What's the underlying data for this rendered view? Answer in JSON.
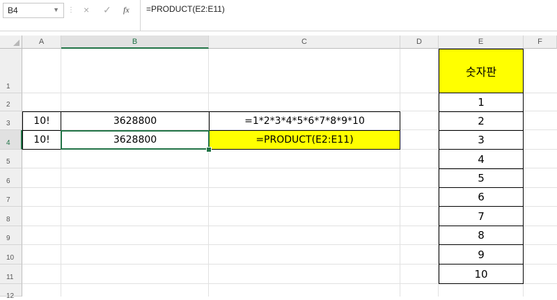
{
  "formula_bar": {
    "name_box": "B4",
    "cancel_icon": "×",
    "enter_icon": "✓",
    "fx_label": "fx",
    "formula": "=PRODUCT(E2:E11)"
  },
  "columns": [
    "A",
    "B",
    "C",
    "D",
    "E",
    "F"
  ],
  "rows": [
    "1",
    "2",
    "3",
    "4",
    "5",
    "6",
    "7",
    "8",
    "9",
    "10",
    "11",
    "12"
  ],
  "cells": {
    "A3": "10!",
    "B3": "3628800",
    "C3": "=1*2*3*4*5*6*7*8*9*10",
    "A4": "10!",
    "B4": "3628800",
    "C4": "=PRODUCT(E2:E11)",
    "E1": "숫자판",
    "E2": "1",
    "E3": "2",
    "E4": "3",
    "E5": "4",
    "E6": "5",
    "E7": "6",
    "E8": "7",
    "E9": "8",
    "E10": "9",
    "E11": "10"
  },
  "colors": {
    "highlight": "#ffff00",
    "selection": "#217346"
  },
  "selected_cell": "B4"
}
